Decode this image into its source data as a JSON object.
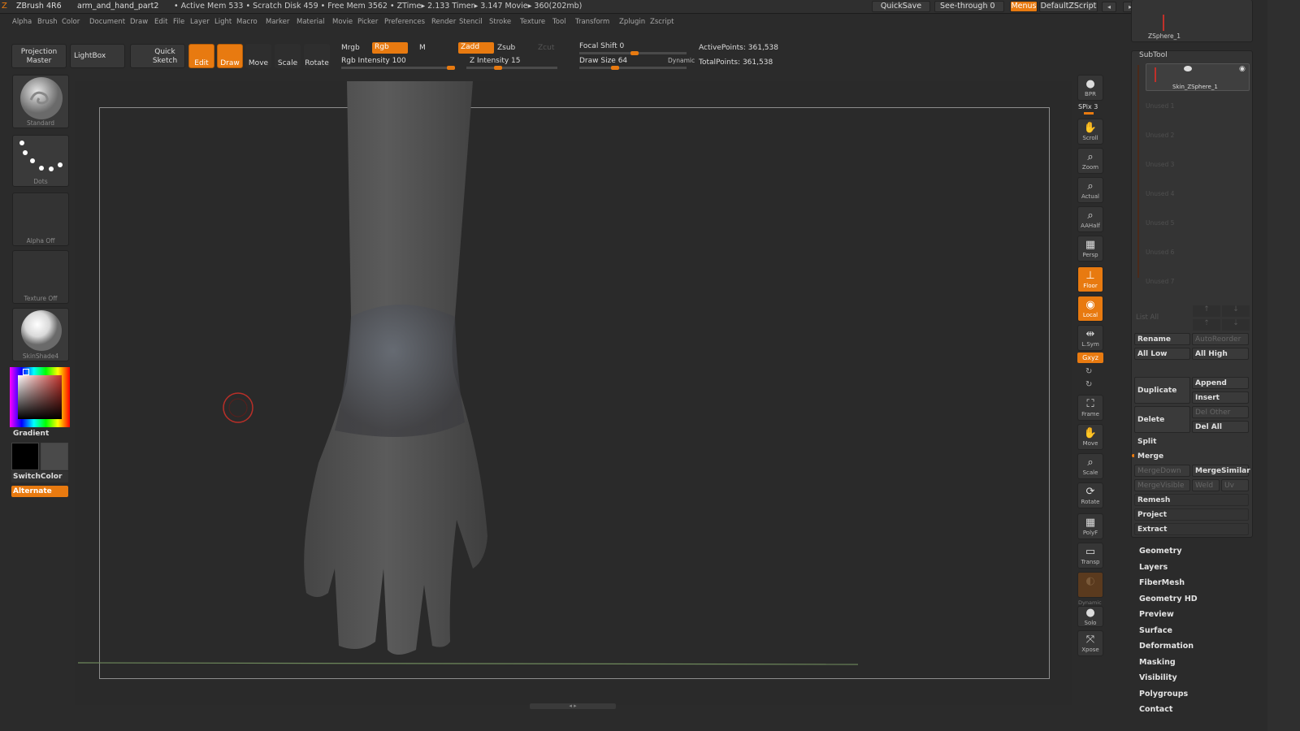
{
  "titlebar": {
    "app": "ZBrush 4R6",
    "doc": "arm_and_hand_part2",
    "stats": "• Active Mem 533 • Scratch Disk 459 • Free Mem 3562 • ZTime▸ 2.133 Timer▸ 3.147 Movie▸ 360(202mb)",
    "quicksave": "QuickSave",
    "seethrough": "See-through   0",
    "menus": "Menus",
    "defaultzscript": "DefaultZScript"
  },
  "menubar": [
    "Alpha",
    "Brush",
    "Color",
    "Document",
    "Draw",
    "Edit",
    "File",
    "Layer",
    "Light",
    "Macro",
    "Marker",
    "Material",
    "Movie",
    "Picker",
    "Preferences",
    "Render",
    "Stencil",
    "Stroke",
    "Texture",
    "Tool",
    "Transform",
    "Zplugin",
    "Zscript"
  ],
  "toolbar": {
    "projection_master": "Projection Master",
    "lightbox": "LightBox",
    "quick_sketch": "Quick Sketch",
    "edit": "Edit",
    "draw": "Draw",
    "move": "Move",
    "scale": "Scale",
    "rotate": "Rotate",
    "mrgb": "Mrgb",
    "rgb": "Rgb",
    "m": "M",
    "rgb_intensity": "Rgb Intensity 100",
    "zadd": "Zadd",
    "zsub": "Zsub",
    "zcut": "Zcut",
    "z_intensity": "Z Intensity 15",
    "focal_shift": "Focal Shift 0",
    "draw_size": "Draw Size 64",
    "dynamic": "Dynamic",
    "active_points": "ActivePoints: 361,538",
    "total_points": "TotalPoints: 361,538",
    "rgb_intensity_value": 100,
    "z_intensity_value": 15,
    "draw_size_value": 64
  },
  "leftshelf": {
    "brush": "Standard",
    "stroke": "Dots",
    "alpha": "Alpha  Off",
    "texture": "Texture  Off",
    "material": "SkinShade4",
    "gradient": "Gradient",
    "switchcolor": "SwitchColor",
    "alternate": "Alternate"
  },
  "rightshelf": {
    "bpr": "BPR",
    "spix": "SPix 3",
    "scroll": "Scroll",
    "zoom": "Zoom",
    "actual": "Actual",
    "aahalf": "AAHalf",
    "persp": "Persp",
    "floor": "Floor",
    "local": "Local",
    "lsym": "L.Sym",
    "xyz": "Gxyz",
    "frame": "Frame",
    "move": "Move",
    "scale": "Scale",
    "rotate": "Rotate",
    "polyf": "PolyF",
    "transp": "Transp",
    "dynamic": "Dynamic",
    "solo": "Solo",
    "xpose": "Xpose"
  },
  "tray": {
    "zsphere_label": "ZSphere_1",
    "subtool_title": "SubTool",
    "active_subtool": "Skin_ZSphere_1",
    "unused_slots": [
      "Unused 1",
      "Unused 2",
      "Unused 3",
      "Unused 4",
      "Unused 5",
      "Unused 6",
      "Unused 7"
    ],
    "list_all": "List  All",
    "rename": "Rename",
    "autoreorder": "AutoReorder",
    "all_low": "All Low",
    "all_high": "All High",
    "duplicate": "Duplicate",
    "append": "Append",
    "insert": "Insert",
    "delete": "Delete",
    "del_other": "Del Other",
    "del_all": "Del All",
    "split": "Split",
    "merge": "Merge",
    "mergedown": "MergeDown",
    "mergesimilar": "MergeSimilar",
    "mergevisible": "MergeVisible",
    "weld": "Weld",
    "uv": "Uv",
    "remesh": "Remesh",
    "project": "Project",
    "extract": "Extract",
    "subpanels": [
      "Geometry",
      "Layers",
      "FiberMesh",
      "Geometry  HD",
      "Preview",
      "Surface",
      "Deformation",
      "Masking",
      "Visibility",
      "Polygroups",
      "Contact"
    ]
  },
  "colors": {
    "accent": "#e87a10",
    "panel_bg": "#2b2b2b",
    "cursor_ring": "#c0302a"
  }
}
